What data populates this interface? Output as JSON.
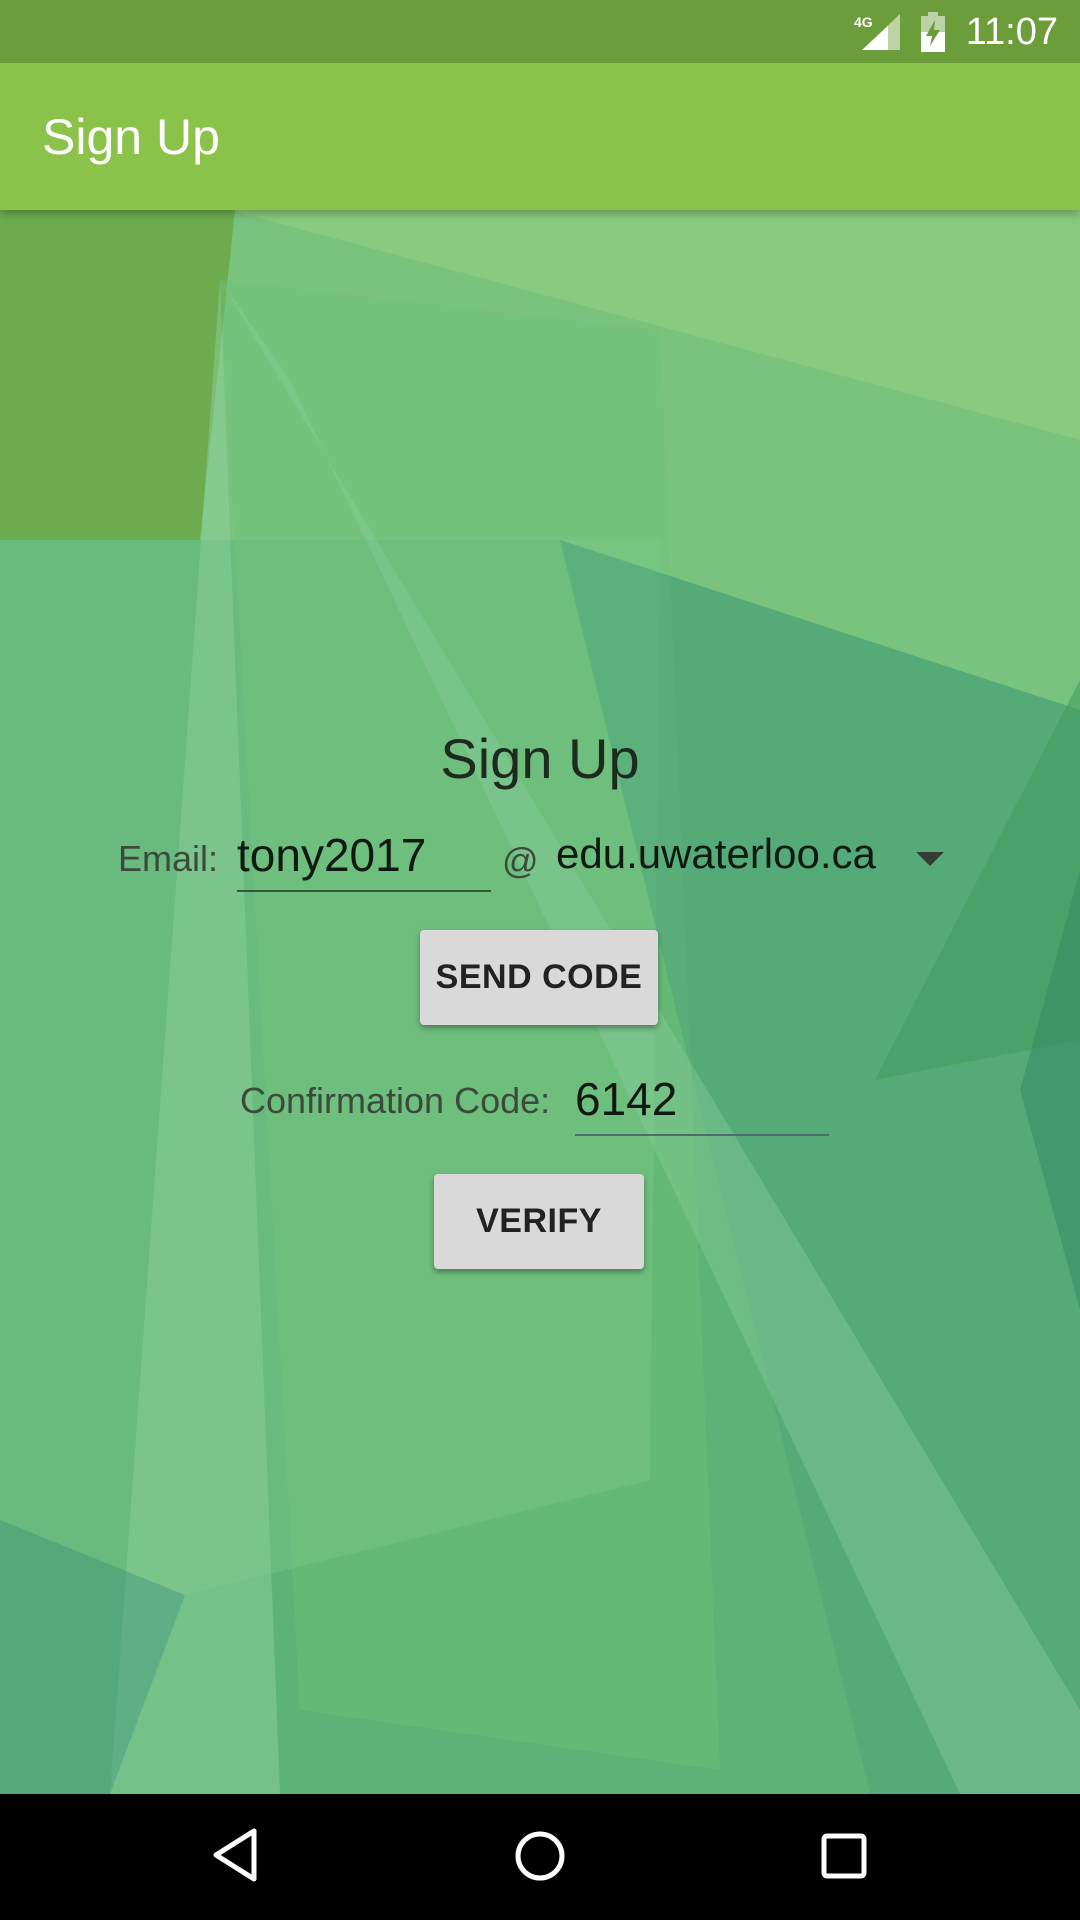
{
  "status_bar": {
    "network": "4G",
    "time": "11:07",
    "icons": [
      "signal-icon",
      "battery-charging-icon"
    ]
  },
  "app_bar": {
    "title": "Sign Up"
  },
  "form": {
    "title": "Sign Up",
    "email_label": "Email:",
    "email_value": "tony2017",
    "at_sign": "@",
    "domain_value": "edu.uwaterloo.ca",
    "send_code_label": "SEND CODE",
    "code_label": "Confirmation Code:",
    "code_value": "6142",
    "verify_label": "VERIFY"
  },
  "nav_bar": {
    "icons": [
      "back-icon",
      "home-icon",
      "recents-icon"
    ]
  },
  "colors": {
    "status_bar": "#6b9e3a",
    "app_bar": "#8bc34a",
    "button": "#d9d9d9"
  }
}
